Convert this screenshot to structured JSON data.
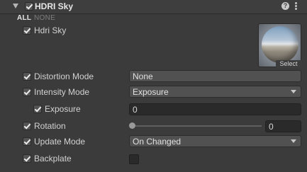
{
  "component": {
    "title": "HDRI Sky",
    "enabled": true,
    "all_label": "ALL",
    "none_label": "NONE"
  },
  "rows": {
    "hdri_sky": {
      "label": "Hdri Sky",
      "checked": true,
      "select_label": "Select"
    },
    "distortion_mode": {
      "label": "Distortion Mode",
      "value": "None",
      "checked": true
    },
    "intensity_mode": {
      "label": "Intensity Mode",
      "value": "Exposure",
      "checked": true
    },
    "exposure": {
      "label": "Exposure",
      "value": "0",
      "checked": true
    },
    "rotation": {
      "label": "Rotation",
      "value": "0",
      "slider_fraction": 0,
      "checked": true
    },
    "update_mode": {
      "label": "Update Mode",
      "value": "On Changed",
      "checked": true
    },
    "backplate": {
      "label": "Backplate",
      "checked": true,
      "value_checked": false
    }
  },
  "icons": {
    "help": "help-icon",
    "menu": "kebab-menu-icon",
    "foldout": "foldout-arrow-icon"
  },
  "colors": {
    "panel_bg": "#3b3b3b",
    "field_bg": "#2a2a2a",
    "dropdown_bg": "#515151",
    "text": "#d2d2d2"
  }
}
